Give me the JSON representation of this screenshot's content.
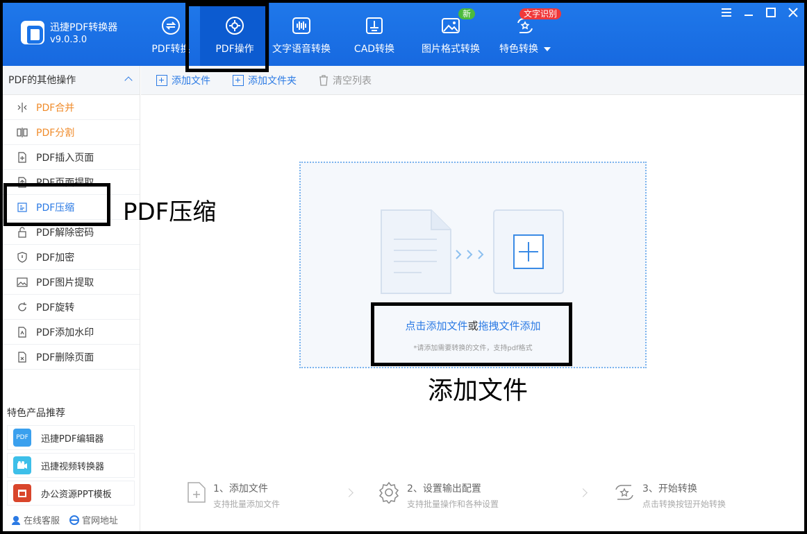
{
  "app": {
    "name": "迅捷PDF转换器",
    "version": "v9.0.3.0"
  },
  "nav": {
    "tabs": [
      {
        "label": "PDF转换",
        "icon": "swap-circle-icon"
      },
      {
        "label": "PDF操作",
        "icon": "gear-circle-icon"
      },
      {
        "label": "文字语音转换",
        "icon": "soundwave-icon"
      },
      {
        "label": "CAD转换",
        "icon": "cad-icon"
      },
      {
        "label": "图片格式转换",
        "icon": "image-icon",
        "badge": "新"
      },
      {
        "label": "特色转换",
        "icon": "star-swap-icon",
        "badge": "文字识别"
      }
    ]
  },
  "sidebar": {
    "header": "PDF的其他操作",
    "items": [
      {
        "label": "PDF合并"
      },
      {
        "label": "PDF分割"
      },
      {
        "label": "PDF插入页面"
      },
      {
        "label": "PDF页面提取"
      },
      {
        "label": "PDF压缩"
      },
      {
        "label": "PDF解除密码"
      },
      {
        "label": "PDF加密"
      },
      {
        "label": "PDF图片提取"
      },
      {
        "label": "PDF旋转"
      },
      {
        "label": "PDF添加水印"
      },
      {
        "label": "PDF删除页面"
      }
    ],
    "recommend_title": "特色产品推荐",
    "recommend": [
      {
        "label": "迅捷PDF编辑器",
        "icon_text": "PDF"
      },
      {
        "label": "迅捷视频转换器"
      },
      {
        "label": "办公资源PPT模板"
      }
    ],
    "footer": {
      "service": "在线客服",
      "website": "官网地址"
    }
  },
  "toolbar": {
    "add_file": "添加文件",
    "add_folder": "添加文件夹",
    "clear_list": "清空列表"
  },
  "dropzone": {
    "click_add": "点击添加文件",
    "or": "或",
    "drag_add": "拖拽文件添加",
    "hint": "*请添加需要转换的文件，支持pdf格式"
  },
  "steps": [
    {
      "title": "1、添加文件",
      "sub": "支持批量添加文件"
    },
    {
      "title": "2、设置输出配置",
      "sub": "支持批量操作和各种设置"
    },
    {
      "title": "3、开始转换",
      "sub": "点击转换按钮开始转换"
    }
  ],
  "annotations": {
    "side": "PDF压缩",
    "dropzone": "添加文件"
  }
}
